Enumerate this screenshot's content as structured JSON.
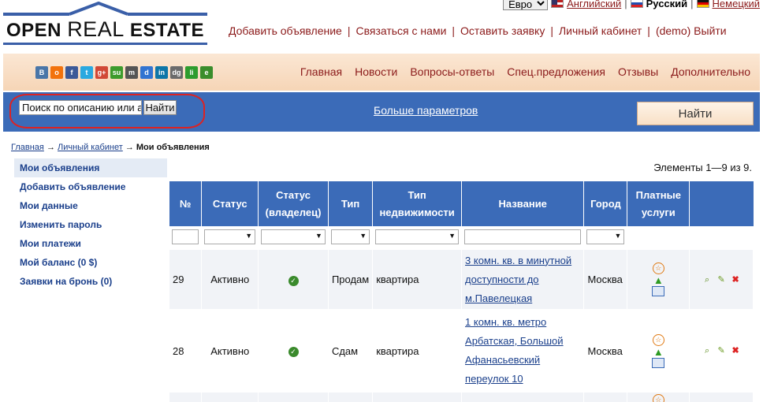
{
  "util": {
    "currency": "Евро",
    "languages": [
      {
        "label": "Английский",
        "current": false
      },
      {
        "label": "Русский",
        "current": true
      },
      {
        "label": "Немецкий",
        "current": false
      }
    ]
  },
  "logo": {
    "part1": "OPEN ",
    "part2": "REAL",
    "part3": " ESTATE"
  },
  "topnav": [
    "Добавить объявление",
    "Связаться с нами",
    "Оставить заявку",
    "Личный кабинет",
    "(demo) Выйти"
  ],
  "social": [
    {
      "name": "vkontakte-icon",
      "glyph": "B",
      "color": "#4a76a8"
    },
    {
      "name": "odnoklassniki-icon",
      "glyph": "о",
      "color": "#f2720c"
    },
    {
      "name": "facebook-icon",
      "glyph": "f",
      "color": "#3b5998"
    },
    {
      "name": "twitter-icon",
      "glyph": "t",
      "color": "#2aa9e0"
    },
    {
      "name": "google-plus-icon",
      "glyph": "g+",
      "color": "#d14836"
    },
    {
      "name": "stumbleupon-icon",
      "glyph": "su",
      "color": "#3d9b2c"
    },
    {
      "name": "myspace-icon",
      "glyph": "m",
      "color": "#555555"
    },
    {
      "name": "delicious-icon",
      "glyph": "d",
      "color": "#3274d1"
    },
    {
      "name": "linkedin-icon",
      "glyph": "in",
      "color": "#0e76a8"
    },
    {
      "name": "digg-icon",
      "glyph": "dg",
      "color": "#6b6b6b"
    },
    {
      "name": "liveinternet-icon",
      "glyph": "li",
      "color": "#2e9c2e"
    },
    {
      "name": "evernote-icon",
      "glyph": "e",
      "color": "#3a8d2c"
    }
  ],
  "mainnav": [
    "Главная",
    "Новости",
    "Вопросы-ответы",
    "Спец.предложения",
    "Отзывы",
    "Дополнительно"
  ],
  "search": {
    "placeholder": "Поиск по описанию или а",
    "button": "Найти",
    "more_link": "Больше параметров",
    "big_button": "Найти"
  },
  "breadcrumb": {
    "home": "Главная",
    "cabinet": "Личный кабинет",
    "current": "Мои объявления",
    "arrow": "→"
  },
  "sidebar": [
    {
      "label": "Мои объявления",
      "active": true
    },
    {
      "label": "Добавить объявление",
      "active": false
    },
    {
      "label": "Мои данные",
      "active": false
    },
    {
      "label": "Изменить пароль",
      "active": false
    },
    {
      "label": "Мои платежи",
      "active": false
    },
    {
      "label": "Мой баланс (0 $)",
      "active": false
    },
    {
      "label": "Заявки на бронь (0)",
      "active": false
    }
  ],
  "grid": {
    "count_text": "Элементы 1—9 из 9.",
    "headers": [
      "№",
      "Статус",
      "Статус (владелец)",
      "Тип",
      "Тип недвижимости",
      "Название",
      "Город",
      "Платные услуги",
      ""
    ],
    "rows": [
      {
        "id": "29",
        "status": "Активно",
        "type": "Продам",
        "realty": "квартира",
        "title": "3 комн. кв. в минутной доступности до м.Павелецкая",
        "city": "Москва"
      },
      {
        "id": "28",
        "status": "Активно",
        "type": "Сдам",
        "realty": "квартира",
        "title": "1 комн. кв. метро Арбатская, Большой Афанасьевский переулок 10",
        "city": "Москва"
      }
    ]
  },
  "colors": {
    "accent_blue": "#3b6bb8",
    "link_red": "#8b1a1a",
    "peach": "#f6d5b6",
    "highlight_red": "#dd2222"
  }
}
